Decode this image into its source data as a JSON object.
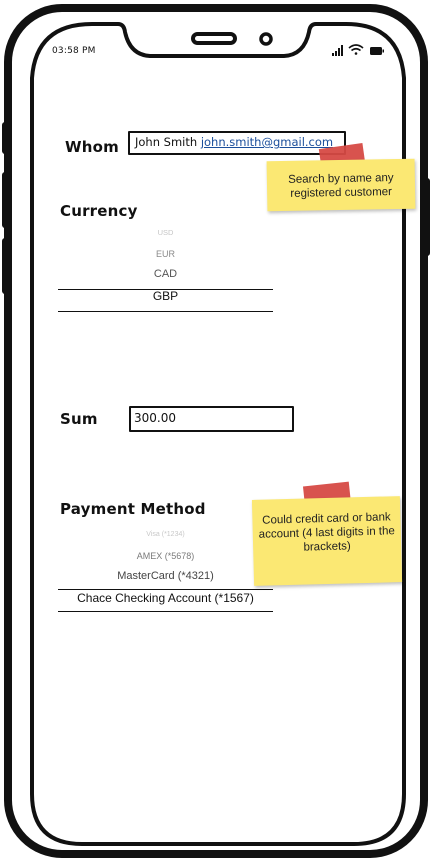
{
  "status_bar": {
    "time": "03:58 PM",
    "icons": [
      "signal-icon",
      "wifi-icon",
      "battery-icon"
    ]
  },
  "form": {
    "whom": {
      "label": "Whom",
      "name": "John Smith",
      "email": "john.smith@gmail.com"
    },
    "currency": {
      "label": "Currency",
      "options": [
        "USD",
        "EUR",
        "CAD",
        "GBP"
      ],
      "selected": "GBP"
    },
    "sum": {
      "label": "Sum",
      "value": "300.00"
    },
    "payment_method": {
      "label": "Payment Method",
      "options": [
        "Visa (*1234)",
        "AMEX (*5678)",
        "MasterCard (*4321)",
        "Chace Checking Account (*1567)"
      ],
      "selected": "Chace Checking Account (*1567)"
    }
  },
  "notes": {
    "search_hint": "Search by name any registered customer",
    "payment_hint": "Could credit card or bank account (4 last digits in the brackets)"
  },
  "colors": {
    "note_yellow": "#fbe873",
    "tape_red": "#d64a45",
    "link_blue": "#1b4e9b",
    "frame": "#000000"
  }
}
